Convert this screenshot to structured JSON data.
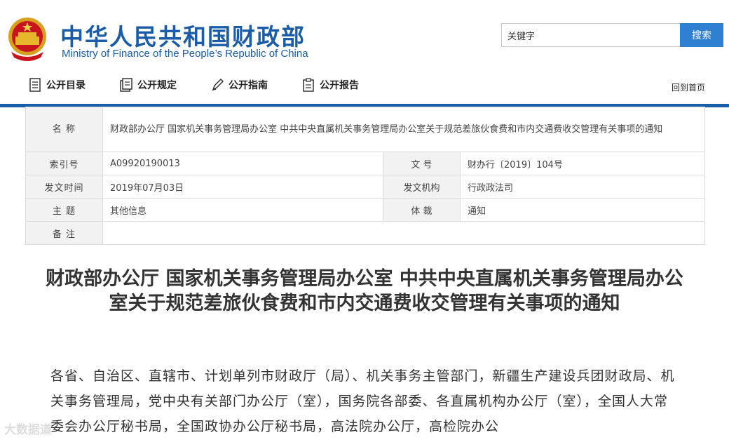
{
  "header": {
    "title": "中华人民共和国财政部",
    "subtitle": "Ministry of Finance of the People’s Republic of China",
    "search_placeholder": "关键字",
    "search_button": "搜索"
  },
  "nav": {
    "items": [
      {
        "label": "公开目录",
        "icon": "catalog-icon"
      },
      {
        "label": "公开规定",
        "icon": "rules-icon"
      },
      {
        "label": "公开指南",
        "icon": "guide-pen-icon"
      },
      {
        "label": "公开报告",
        "icon": "report-icon"
      }
    ],
    "home_link": "回到首页"
  },
  "meta": {
    "name_label": "名 称",
    "name_value": "财政部办公厅 国家机关事务管理局办公室 中共中央直属机关事务管理局办公室关于规范差旅伙食费和市内交通费收交管理有关事项的通知",
    "index_label": "索引号",
    "index_value": "A09920190013",
    "doc_no_label": "文 号",
    "doc_no_value": "财办行〔2019〕104号",
    "date_label": "发文时间",
    "date_value": "2019年07月03日",
    "issuer_label": "发文机构",
    "issuer_value": "行政政法司",
    "topic_label": "主 题",
    "topic_value": "其他信息",
    "genre_label": "体 裁",
    "genre_value": "通知",
    "note_label": "备 注",
    "note_value": ""
  },
  "document": {
    "title": "财政部办公厅 国家机关事务管理局办公室 中共中央直属机关事务管理局办公室关于规范差旅伙食费和市内交通费收交管理有关事项的通知",
    "body": "各省、自治区、直辖市、计划单列市财政厅（局）、机关事务主管部门，新疆生产建设兵团财政局、机关事务管理局，党中央有关部门办公厅（室），国务院各部委、各直属机构办公厅（室），全国人大常委会办公厅秘书局，全国政协办公厅秘书局，高法院办公厅，高检院办公"
  },
  "watermark": "大数据道"
}
